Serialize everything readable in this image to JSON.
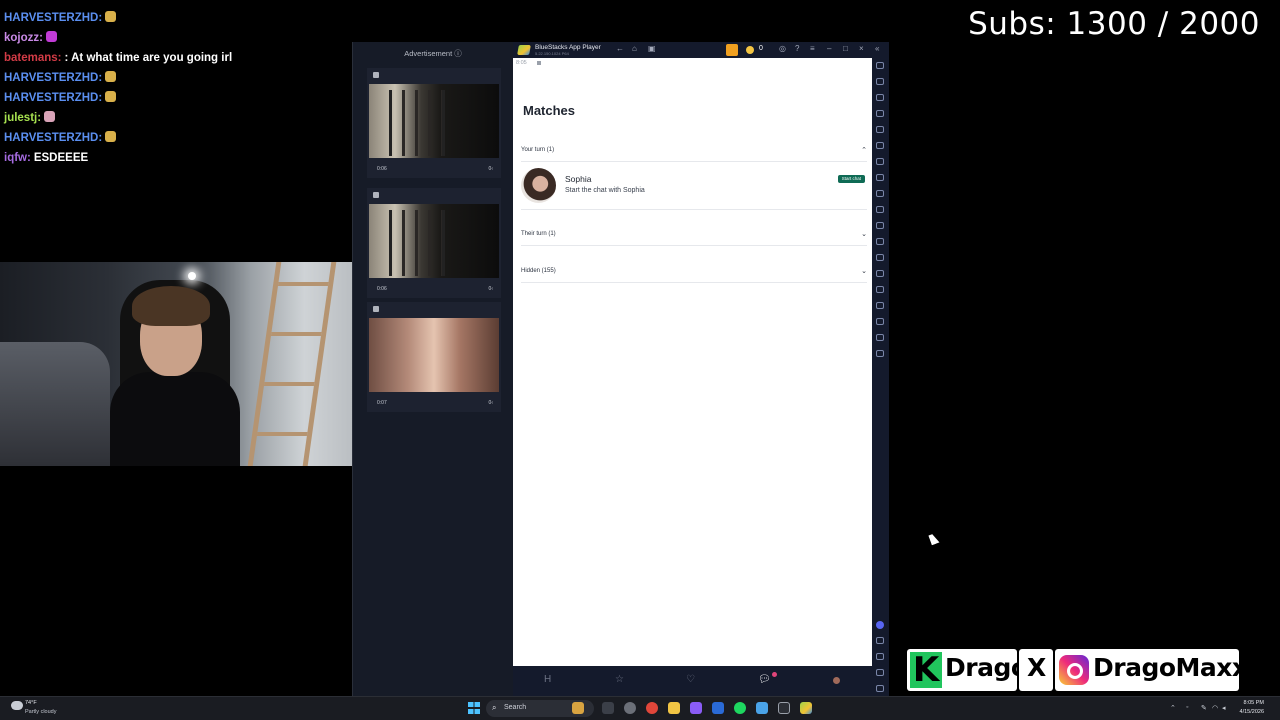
{
  "chat": [
    {
      "user": "HARVESTERZHD:",
      "user_color": "#5b8ff0",
      "message": "",
      "emote": "#d8b04a"
    },
    {
      "user": "kojozz:",
      "user_color": "#c98ae6",
      "message": "",
      "emote": "#c13bd6"
    },
    {
      "user": "batemans:",
      "user_color": "#d23b46",
      "message": ": At what time are you going irl",
      "emote": ""
    },
    {
      "user": "HARVESTERZHD:",
      "user_color": "#5b8ff0",
      "message": "",
      "emote": "#d8b04a"
    },
    {
      "user": "HARVESTERZHD:",
      "user_color": "#5b8ff0",
      "message": "",
      "emote": "#d8b04a"
    },
    {
      "user": "julestj:",
      "user_color": "#a6e04f",
      "message": "",
      "emote": "#d9a3b8"
    },
    {
      "user": "HARVESTERZHD:",
      "user_color": "#5b8ff0",
      "message": "",
      "emote": "#d8b04a"
    },
    {
      "user": "iqfw:",
      "user_color": "#a66be0",
      "message": "ESDEEEE",
      "emote": ""
    }
  ],
  "subs_counter": "Subs: 1300 / 2000",
  "ads": {
    "title": "Advertisement ⓘ",
    "cards": [
      {
        "time": "0:06",
        "vol": "0‹"
      },
      {
        "time": "0:06",
        "vol": "0‹"
      },
      {
        "time": "0:07",
        "vol": "0‹"
      }
    ]
  },
  "bluestacks": {
    "name": "BlueStacks App Player",
    "version": "5.22.150.1024 P64",
    "coins": "0",
    "status_time": "8:05"
  },
  "app": {
    "title": "Matches",
    "sections": [
      {
        "label": "Your turn (1)",
        "chevron": "⌃"
      },
      {
        "label": "Their turn (1)",
        "chevron": "⌄"
      },
      {
        "label": "Hidden (155)",
        "chevron": "⌄"
      }
    ],
    "match": {
      "name": "Sophia",
      "subtitle": "Start the chat with Sophia",
      "action": "Start chat"
    }
  },
  "social": {
    "k_letter": "K",
    "handle1": "Drago",
    "x_symbol": "X",
    "handle2": "DragoMaxxer"
  },
  "taskbar": {
    "temperature": "74°F",
    "condition": "Partly cloudy",
    "search_label": "Search",
    "time": "8:05 PM",
    "date": "4/15/2026"
  },
  "colors": {
    "start_chat": "#0f6b55",
    "social_green": "#21c55d",
    "windows_blue": "#4cc2ff"
  }
}
